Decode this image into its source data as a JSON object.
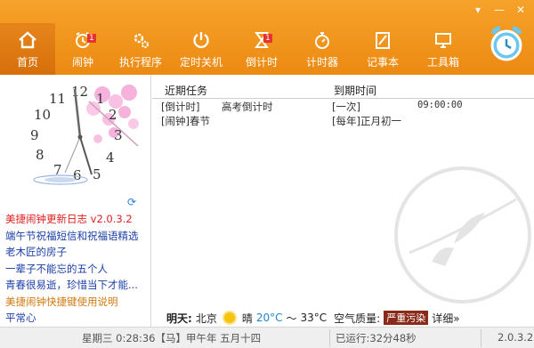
{
  "toolbar": {
    "items": [
      {
        "label": "首页",
        "icon": "home-icon"
      },
      {
        "label": "闹钟",
        "icon": "alarm-icon",
        "badge": "1"
      },
      {
        "label": "执行程序",
        "icon": "program-gear-icon"
      },
      {
        "label": "定时关机",
        "icon": "power-icon"
      },
      {
        "label": "倒计时",
        "icon": "hourglass-icon",
        "badge": "1"
      },
      {
        "label": "计时器",
        "icon": "stopwatch-icon"
      },
      {
        "label": "记事本",
        "icon": "notepad-icon"
      },
      {
        "label": "工具箱",
        "icon": "monitor-icon"
      }
    ]
  },
  "window_controls": {
    "menu": "▾",
    "minimize": "—",
    "close": "✕"
  },
  "clock": {
    "numbers": [
      "12",
      "1",
      "2",
      "3",
      "4",
      "5",
      "6",
      "7",
      "8",
      "9",
      "10",
      "11"
    ],
    "time": "0:28:36"
  },
  "links": [
    {
      "text": "美捷闹钟更新日志  v2.0.3.2",
      "color": "#e02020"
    },
    {
      "text": "端午节祝福短信和祝福语精选",
      "color": "#1b3fa8"
    },
    {
      "text": "老木匠的房子",
      "color": "#1b3fa8"
    },
    {
      "text": "一辈子不能忘的五个人",
      "color": "#1b3fa8"
    },
    {
      "text": "青春很易逝，珍惜当下才能...",
      "color": "#1b3fa8"
    },
    {
      "text": "美捷闹钟快捷键使用说明",
      "color": "#d07a10"
    },
    {
      "text": "平常心",
      "color": "#1b3fa8"
    }
  ],
  "tasks": {
    "col_task": "近期任务",
    "col_due": "到期时间",
    "rows": [
      {
        "type": "[倒计时]",
        "name": "高考倒计时",
        "when": "[一次]",
        "time": "09:00:00"
      },
      {
        "type": "[闹钟]春节",
        "name": "",
        "when": "[每年]正月初一",
        "time": ""
      }
    ]
  },
  "weather": {
    "day": "明天:",
    "city": "北京",
    "condition": "晴",
    "temp_low": "20°C",
    "temp_sep": "～",
    "temp_high": "33°C",
    "aq_label": "空气质量:",
    "aq_value": "严重污染",
    "detail": "详细»"
  },
  "status": {
    "date": "星期三 0:28:36【马】甲午年 五月十四",
    "running": "已运行:32分48秒",
    "version": "2.0.3.2"
  },
  "colors": {
    "accent": "#f29a22",
    "link": "#1b3fa8",
    "alert": "#e02020"
  }
}
